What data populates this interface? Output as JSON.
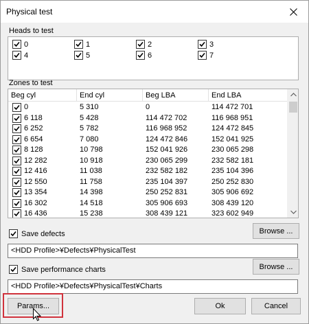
{
  "window": {
    "title": "Physical test"
  },
  "heads": {
    "label": "Heads to test",
    "items": [
      {
        "label": "0",
        "checked": true
      },
      {
        "label": "1",
        "checked": true
      },
      {
        "label": "2",
        "checked": true
      },
      {
        "label": "3",
        "checked": true
      },
      {
        "label": "4",
        "checked": true
      },
      {
        "label": "5",
        "checked": true
      },
      {
        "label": "6",
        "checked": true
      },
      {
        "label": "7",
        "checked": true
      }
    ]
  },
  "zones": {
    "label": "Zones to test",
    "columns": [
      "Beg cyl",
      "End cyl",
      "Beg LBA",
      "End LBA"
    ],
    "rows": [
      [
        "0",
        "5 310",
        "0",
        "114 472 701"
      ],
      [
        "6 118",
        "5 428",
        "114 472 702",
        "116 968 951"
      ],
      [
        "6 252",
        "5 782",
        "116 968 952",
        "124 472 845"
      ],
      [
        "6 654",
        "7 080",
        "124 472 846",
        "152 041 925"
      ],
      [
        "8 128",
        "10 798",
        "152 041 926",
        "230 065 298"
      ],
      [
        "12 282",
        "10 918",
        "230 065 299",
        "232 582 181"
      ],
      [
        "12 416",
        "11 038",
        "232 582 182",
        "235 104 396"
      ],
      [
        "12 550",
        "11 758",
        "235 104 397",
        "250 252 830"
      ],
      [
        "13 354",
        "14 398",
        "250 252 831",
        "305 906 692"
      ],
      [
        "16 302",
        "14 518",
        "305 906 693",
        "308 439 120"
      ],
      [
        "16 436",
        "15 238",
        "308 439 121",
        "323 602 949"
      ]
    ]
  },
  "save_defects": {
    "label": "Save defects",
    "checked": true,
    "path": "<HDD Profile>¥Defects¥PhysicalTest",
    "browse_label": "Browse ..."
  },
  "save_charts": {
    "label": "Save performance charts",
    "checked": true,
    "path": "<HDD Profile>¥Defects¥PhysicalTest¥Charts",
    "browse_label": "Browse ..."
  },
  "buttons": {
    "params": "Params...",
    "ok": "Ok",
    "cancel": "Cancel"
  },
  "colors": {
    "highlight": "#d0323c",
    "window_bg": "#f0f0f0",
    "button_bg": "#e1e1e1"
  }
}
